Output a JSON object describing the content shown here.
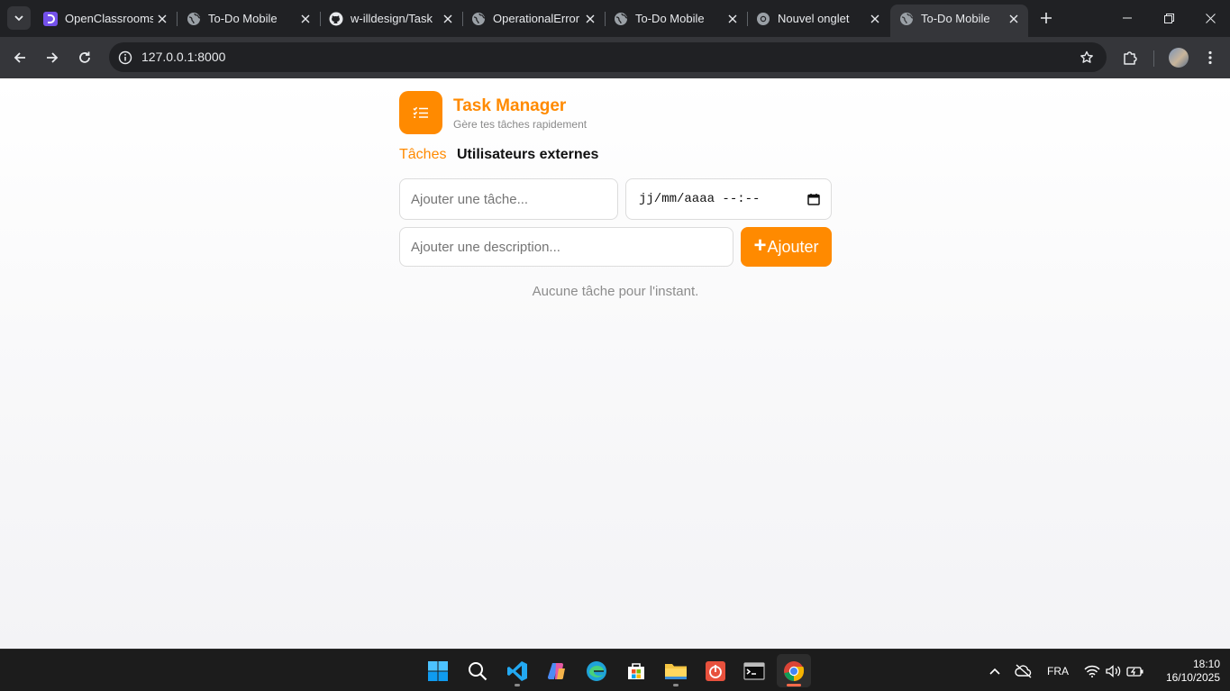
{
  "browser": {
    "tabs": [
      {
        "title": "OpenClassrooms",
        "favicon": "openclassrooms-icon"
      },
      {
        "title": "To-Do Mobile",
        "favicon": "globe-icon"
      },
      {
        "title": "w-illdesign/Task",
        "favicon": "github-icon"
      },
      {
        "title": "OperationalError",
        "favicon": "globe-icon"
      },
      {
        "title": "To-Do Mobile",
        "favicon": "globe-icon"
      },
      {
        "title": "Nouvel onglet",
        "favicon": "chrome-icon"
      },
      {
        "title": "To-Do Mobile",
        "favicon": "globe-icon",
        "active": true
      }
    ],
    "url": "127.0.0.1:8000"
  },
  "app": {
    "title": "Task Manager",
    "subtitle": "Gère tes tâches rapidement",
    "nav": {
      "tasks": "Tâches",
      "external_users": "Utilisateurs externes"
    },
    "form": {
      "task_placeholder": "Ajouter une tâche...",
      "date_placeholder": "jj/mm/aaaa --:--",
      "description_placeholder": "Ajouter une description...",
      "add_label": "Ajouter"
    },
    "empty_message": "Aucune tâche pour l'instant."
  },
  "taskbar": {
    "apps": [
      "windows-start-icon",
      "search-icon",
      "vscode-icon",
      "copilot-icon",
      "edge-icon",
      "store-icon",
      "file-explorer-icon",
      "power-app-icon",
      "terminal-icon",
      "chrome-icon"
    ],
    "language": "FRA",
    "time": "18:10",
    "date": "16/10/2025"
  },
  "colors": {
    "accent": "#ff8a00",
    "chrome_dark": "#202124",
    "chrome_toolbar": "#35363a"
  }
}
